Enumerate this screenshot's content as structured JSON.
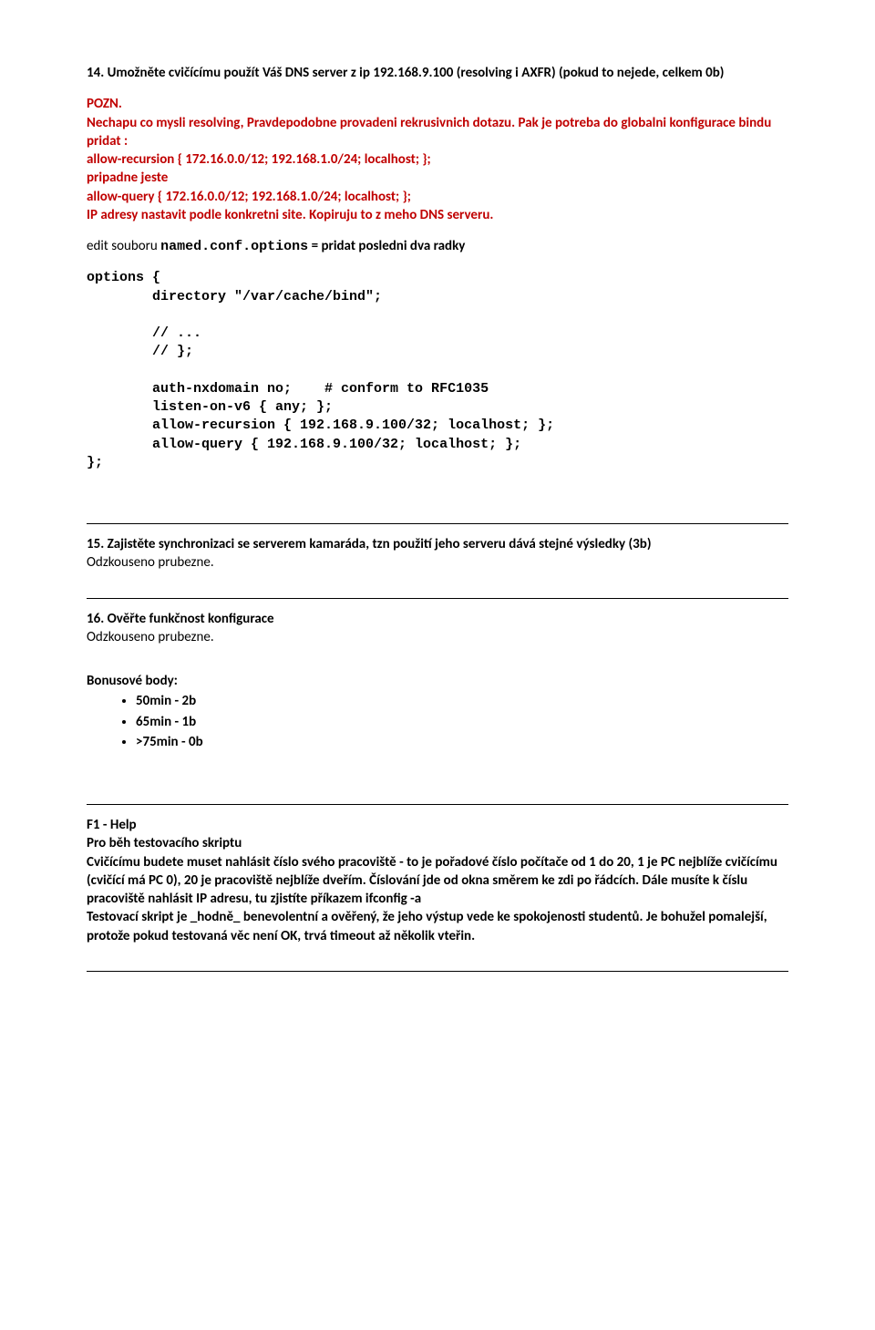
{
  "q14": {
    "title": "14. Umožněte cvičícímu použít Váš DNS server z ip 192.168.9.100 (resolving i AXFR) (pokud to nejede, celkem 0b)",
    "pozn_label": "POZN.",
    "pozn_body": "Nechapu co mysli resolving, Pravdepodobne provadeni rekrusivnich dotazu. Pak je potreba do globalni konfigurace bindu pridat :",
    "cfg1": "allow-recursion { 172.16.0.0/12; 192.168.1.0/24; localhost; };",
    "cfg_between": "pripadne jeste",
    "cfg2": "allow-query { 172.16.0.0/12; 192.168.1.0/24; localhost; };",
    "cfg_after": "IP adresy nastavit podle konkretni site. Kopiruju to z meho DNS serveru.",
    "edit_prefix": "edit souboru ",
    "edit_file": "named.conf.options",
    "edit_suffix": " = pridat posledni dva radky",
    "code": "options {\n        directory \"/var/cache/bind\";\n\n        // ...\n        // };\n\n        auth-nxdomain no;    # conform to RFC1035\n        listen-on-v6 { any; };\n        allow-recursion { 192.168.9.100/32; localhost; };\n        allow-query { 192.168.9.100/32; localhost; };\n};"
  },
  "q15": {
    "title": "15. Zajistěte synchronizaci se serverem kamaráda, tzn použití jeho serveru dává stejné výsledky (3b)",
    "body": "Odzkouseno prubezne."
  },
  "q16": {
    "title": "16. Ověřte funkčnost konfigurace",
    "body": "Odzkouseno prubezne."
  },
  "bonus": {
    "title": "Bonusové body:",
    "items": [
      "50min - 2b",
      "65min - 1b",
      ">75min - 0b"
    ]
  },
  "help": {
    "title": "F1 - Help",
    "l1": "Pro běh testovacího skriptu",
    "l2": "Cvičícímu budete muset nahlásit číslo svého pracoviště - to je pořadové číslo počítače od 1 do 20, 1 je PC nejblíže cvičícímu (cvičící má PC 0), 20 je pracoviště nejblíže dveřím. Číslování jde od okna směrem ke zdi po řádcích. Dále musíte k číslu pracoviště nahlásit IP adresu, tu zjistíte příkazem ifconfig -a",
    "l3": "Testovací skript je _hodně_ benevolentní a ověřený, že jeho výstup vede ke spokojenosti studentů. Je bohužel pomalejší, protože pokud testovaná věc není OK, trvá timeout až několik vteřin."
  }
}
